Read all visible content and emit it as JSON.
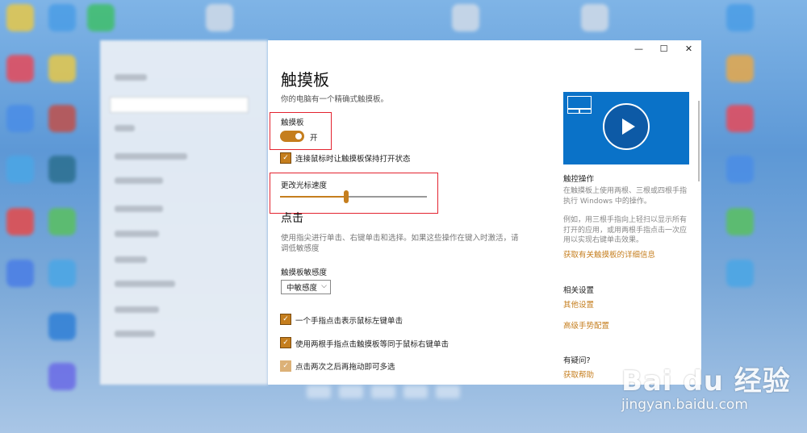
{
  "window": {
    "minimize": "—",
    "maximize": "☐",
    "close": "✕"
  },
  "page": {
    "title": "触摸板",
    "subtitle": "你的电脑有一个精确式触摸板。"
  },
  "touchpad": {
    "label": "触摸板",
    "toggle_state": "开",
    "keep_on_label": "连接鼠标时让触摸板保持打开状态"
  },
  "cursor_speed": {
    "label": "更改光标速度",
    "value": 0.45
  },
  "taps": {
    "heading": "点击",
    "description": "使用指尖进行单击、右键单击和选择。如果这些操作在键入时激活，请调低敏感度",
    "sensitivity_label": "触摸板敏感度",
    "sensitivity_value": "中敏感度",
    "options": [
      "一个手指点击表示鼠标左键单击",
      "使用两根手指点击触摸板等同于鼠标右键单击",
      "点击两次之后再拖动即可多选"
    ]
  },
  "side": {
    "gesture_heading": "触控操作",
    "gesture_text1": "在触摸板上使用两根、三根或四根手指执行 Windows 中的操作。",
    "gesture_text2": "例如，用三根手指向上轻扫以显示所有打开的应用，或用两根手指点击一次应用以实现右键单击效果。",
    "gesture_link": "获取有关触摸板的详细信息",
    "related_heading": "相关设置",
    "related_links": [
      "其他设置",
      "高级手势配置"
    ],
    "question_heading": "有疑问?",
    "help_link": "获取帮助"
  },
  "watermark": {
    "main": "Bai du 经验",
    "sub": "jingyan.baidu.com"
  },
  "colors": {
    "accent": "#c57e1e",
    "highlight_box": "#e3232f",
    "video_bg": "#0a72c8"
  }
}
